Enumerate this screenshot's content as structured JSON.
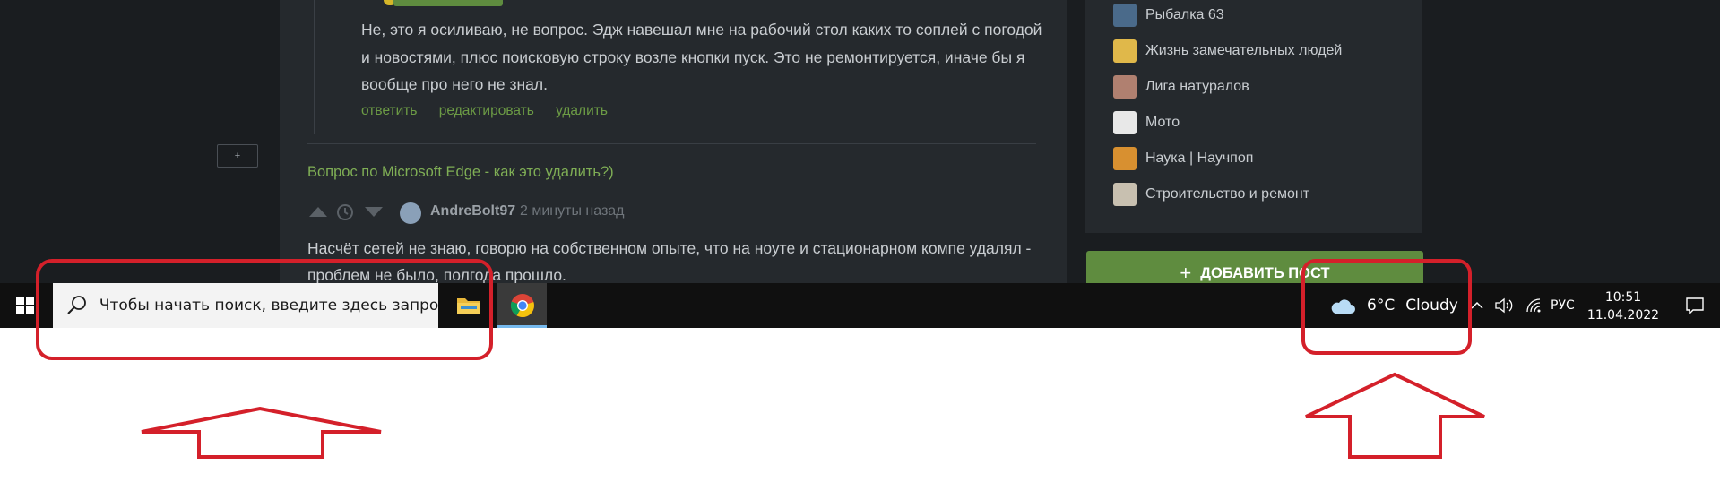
{
  "browser_page": {
    "reply": {
      "text": "Не, это я осиливаю, не вопрос. Эдж навешал мне на рабочий стол каких то соплей с погодой и новостями, плюс поисковую строку возле кнопки пуск. Это не ремонтируется, иначе бы я вообще про него не знал.",
      "actions": [
        "ответить",
        "редактировать",
        "удалить"
      ]
    },
    "collapse_button": "+",
    "post_link": "Вопрос по Microsoft Edge - как это удалить?)",
    "comment": {
      "author": "AndreBolt97",
      "time": "2 минуты назад",
      "text": "Насчёт сетей не знаю, говорю на собственном опыте, что на ноуте и стационарном компе удалял - проблем не было, полгода прошло."
    },
    "communities": [
      {
        "label": "Рыбалка 63",
        "icon": "fishing-community-icon",
        "color": "#4a6a8a"
      },
      {
        "label": "Жизнь замечательных людей",
        "icon": "people-community-icon",
        "color": "#e0b84a"
      },
      {
        "label": "Лига натуралов",
        "icon": "naturalists-community-icon",
        "color": "#b08070"
      },
      {
        "label": "Мото",
        "icon": "moto-community-icon",
        "color": "#e8e8e8"
      },
      {
        "label": "Наука | Научпоп",
        "icon": "science-community-icon",
        "color": "#d89030"
      },
      {
        "label": "Строительство и ремонт",
        "icon": "construction-community-icon",
        "color": "#c8c0b0"
      }
    ],
    "add_post_label": "ДОБАВИТЬ ПОСТ",
    "accent_color": "#5f8c3f"
  },
  "taskbar": {
    "search_placeholder": "Чтобы начать поиск, введите здесь запрос",
    "apps": [
      {
        "name": "file-explorer",
        "icon": "folder-icon"
      },
      {
        "name": "chrome",
        "icon": "chrome-icon",
        "active": true
      }
    ],
    "weather": {
      "temp": "6°C",
      "condition": "Cloudy",
      "icon": "cloud-icon"
    },
    "tray_icons": [
      "chevron-up-icon",
      "volume-icon",
      "wifi-icon"
    ],
    "language": "РУС",
    "time": "10:51",
    "date": "11.04.2022",
    "notification_icon": "notification-icon"
  },
  "annotations": {
    "highlight_color": "#d4202a",
    "targets": [
      "search-box",
      "weather-widget"
    ]
  }
}
